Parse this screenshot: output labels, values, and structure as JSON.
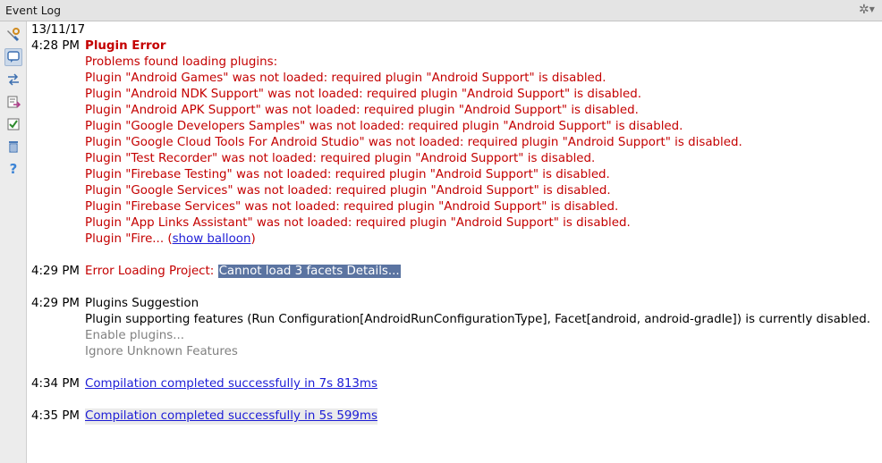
{
  "window": {
    "title": "Event Log"
  },
  "toolbar": {
    "items": [
      "settings-icon",
      "balloon-icon",
      "compare-icon",
      "export-icon",
      "checkbox-icon",
      "trash-icon",
      "help-icon"
    ]
  },
  "log": {
    "date": "13/11/17",
    "entry1": {
      "time": "4:28 PM",
      "title": "Plugin Error",
      "intro": "Problems found loading plugins:",
      "lines": [
        "Plugin \"Android Games\" was not loaded: required plugin \"Android Support\" is disabled.",
        "Plugin \"Android NDK Support\" was not loaded: required plugin \"Android Support\" is disabled.",
        "Plugin \"Android APK Support\" was not loaded: required plugin \"Android Support\" is disabled.",
        "Plugin \"Google Developers Samples\" was not loaded: required plugin \"Android Support\" is disabled.",
        "Plugin \"Google Cloud Tools For Android Studio\" was not loaded: required plugin \"Android Support\" is disabled.",
        "Plugin \"Test Recorder\" was not loaded: required plugin \"Android Support\" is disabled.",
        "Plugin \"Firebase Testing\" was not loaded: required plugin \"Android Support\" is disabled.",
        "Plugin \"Google Services\" was not loaded: required plugin \"Android Support\" is disabled.",
        "Plugin \"Firebase Services\" was not loaded: required plugin \"Android Support\" is disabled.",
        "Plugin \"App Links Assistant\" was not loaded: required plugin \"Android Support\" is disabled."
      ],
      "truncated_prefix": "Plugin \"Fire... (",
      "show_balloon": "show balloon",
      "truncated_suffix": ")"
    },
    "entry2": {
      "time": "4:29 PM",
      "prefix": "Error Loading Project: ",
      "selected": "Cannot load 3 facets Details..."
    },
    "entry3": {
      "time": "4:29 PM",
      "title": "Plugins Suggestion",
      "text": "Plugin supporting features (Run Configuration[AndroidRunConfigurationType], Facet[android, android-gradle]) is currently disabled.",
      "enable": "Enable plugins...",
      "ignore": "Ignore Unknown Features"
    },
    "entry4": {
      "time": "4:34 PM",
      "link": "Compilation completed successfully in 7s 813ms"
    },
    "entry5": {
      "time": "4:35 PM",
      "link": "Compilation completed successfully in 5s 599ms"
    }
  }
}
